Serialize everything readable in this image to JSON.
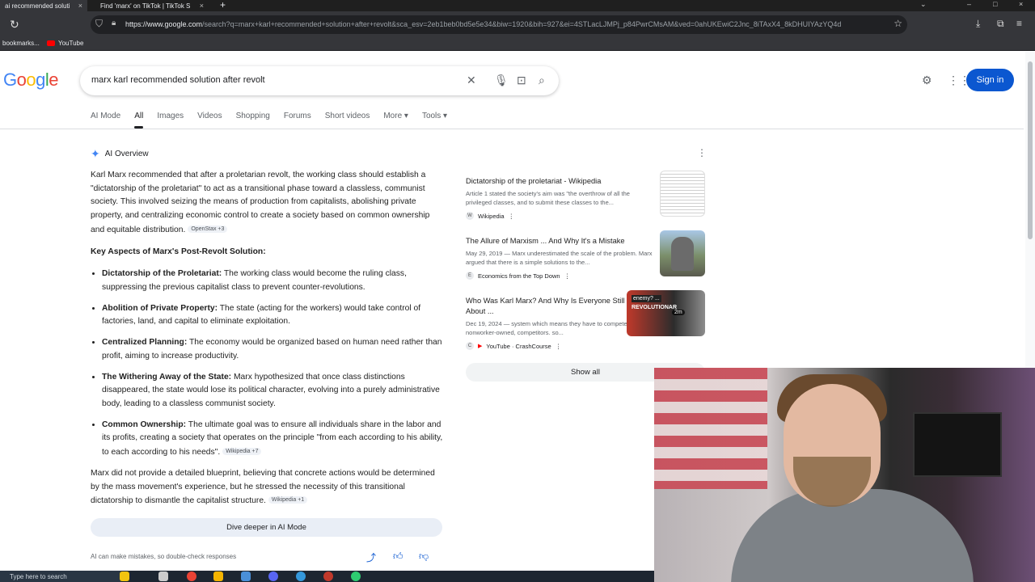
{
  "browser": {
    "tabs": [
      {
        "title": "ai recommended soluti"
      },
      {
        "title": "Find 'marx' on TikTok | TikTok S"
      }
    ],
    "url_host": "https://www.google.com",
    "url_path": "/search?q=marx+karl+recommended+solution+after+revolt&sca_esv=2eb1beb0bd5e5e34&biw=1920&bih=927&ei=4STLacLJMPj_p84PwrCMsAM&ved=0ahUKEwiC2Jnc_8iTAxX4_8kDHUIYAzYQ4d",
    "bookmarks": [
      {
        "label": "bookmarks..."
      },
      {
        "label": "YouTube"
      }
    ]
  },
  "header": {
    "logo": [
      "G",
      "o",
      "o",
      "g",
      "l",
      "e"
    ],
    "query": "marx karl recommended solution after revolt",
    "signin": "Sign in"
  },
  "nav": {
    "tabs": [
      {
        "label": "AI Mode"
      },
      {
        "label": "All"
      },
      {
        "label": "Images"
      },
      {
        "label": "Videos"
      },
      {
        "label": "Shopping"
      },
      {
        "label": "Forums"
      },
      {
        "label": "Short videos"
      },
      {
        "label": "More ▾"
      },
      {
        "label": "Tools ▾"
      }
    ]
  },
  "ai": {
    "heading": "AI Overview",
    "intro": "Karl Marx recommended that after a proletarian revolt, the working class should establish a \"dictatorship of the proletariat\" to act as a transitional phase toward a classless, communist society. This involved seizing the means of production from capitalists, abolishing private property, and centralizing economic control to create a society based on common ownership and equitable distribution.",
    "intro_chip": "OpenStax +3",
    "key_heading": "Key Aspects of Marx's Post-Revolt Solution:",
    "items": [
      {
        "term": "Dictatorship of the Proletariat:",
        "text": " The working class would become the ruling class, suppressing the previous capitalist class to prevent counter-revolutions."
      },
      {
        "term": "Abolition of Private Property:",
        "text": " The state (acting for the workers) would take control of factories, land, and capital to eliminate exploitation."
      },
      {
        "term": "Centralized Planning:",
        "text": " The economy would be organized based on human need rather than profit, aiming to increase productivity."
      },
      {
        "term": "The Withering Away of the State:",
        "text": " Marx hypothesized that once class distinctions disappeared, the state would lose its political character, evolving into a purely administrative body, leading to a classless communist society."
      },
      {
        "term": "Common Ownership:",
        "text": " The ultimate goal was to ensure all individuals share in the labor and its profits, creating a society that operates on the principle \"from each according to his ability, to each according to his needs\".",
        "chip": "Wikipedia +7"
      }
    ],
    "closing": "Marx did not provide a detailed blueprint, believing that concrete actions would be determined by the mass movement's experience, but he stressed the necessity of this transitional dictatorship to dismantle the capitalist structure.",
    "closing_chip": "Wikipedia +1",
    "dive_button": "Dive deeper in AI Mode",
    "disclaimer": "AI can make mistakes, so double-check responses"
  },
  "sources": [
    {
      "title": "Dictatorship of the proletariat - Wikipedia",
      "snippet": "Article 1 stated the society's aim was \"the overthrow of all the privileged classes, and to submit these classes to the...",
      "site": "Wikipedia"
    },
    {
      "title": "The Allure of Marxism ... And Why It's a Mistake",
      "snippet": "May 29, 2019 — Marx underestimated the scale of the problem. Marx argued that there is a simple solutions to the...",
      "site": "Economics from the Top Down"
    },
    {
      "title": "Who Was Karl Marx? And Why Is Everyone Still Talking About ...",
      "snippet": "Dec 19, 2024 — system which means they have to compete with nonworker-owned, competitors. so...",
      "site": "YouTube · CrashCourse",
      "thumb_text1": "enemy? ...",
      "thumb_text2": "REVOLUTIONAR",
      "duration": "2m"
    }
  ],
  "show_all": "Show all",
  "taskbar": {
    "search": "Type here to search"
  },
  "colors": {
    "accent": "#0b57d0",
    "chrome": "#35363a"
  }
}
